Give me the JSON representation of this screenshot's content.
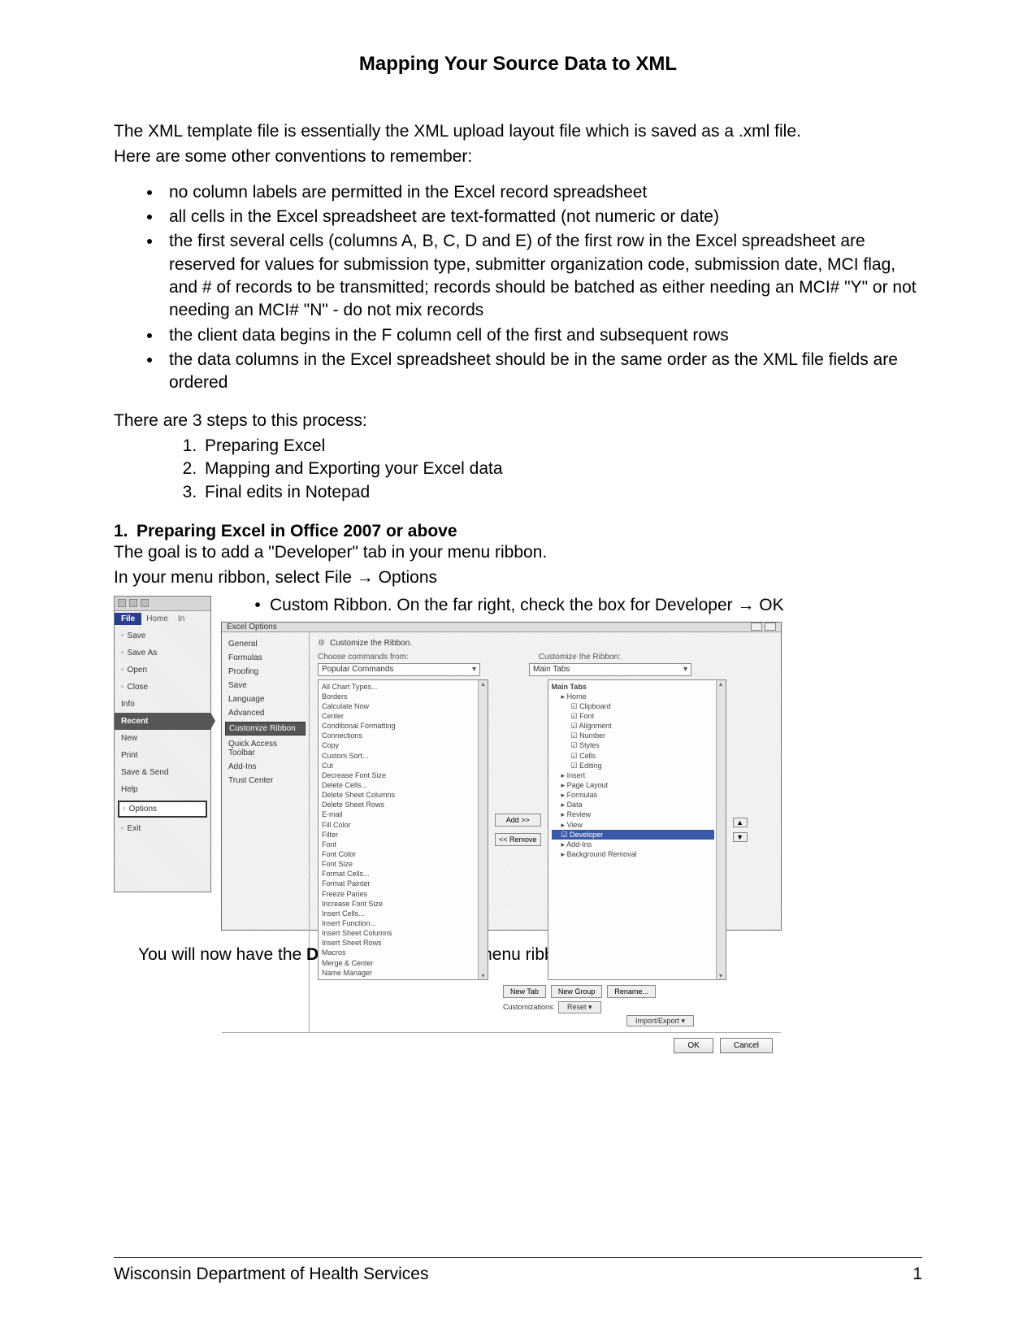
{
  "title": "Mapping Your Source Data to XML",
  "intro1": "The XML template file is essentially the XML upload layout file which is saved as a .xml file.",
  "intro2": "Here are some other conventions to remember:",
  "bullets": [
    "no column labels are permitted in the Excel record spreadsheet",
    "all cells in the Excel spreadsheet are text-formatted (not numeric or date)",
    "the first several cells (columns A, B, C, D and E) of the first row in the Excel spreadsheet are reserved for values for submission type, submitter organization code, submission date, MCI flag, and # of records to be transmitted; records should be batched as either needing an MCI# \"Y\" or not needing an MCI# \"N\" - do not mix records",
    "the client data begins in the F column cell of the first and subsequent rows",
    "the data columns in the Excel spreadsheet should be in the same order as the XML file fields are ordered"
  ],
  "steps_intro": "There are 3 steps to this process:",
  "steps": [
    "Preparing Excel",
    "Mapping and Exporting your Excel data",
    "Final edits in Notepad"
  ],
  "section1": {
    "num": "1.",
    "heading": "Preparing Excel in Office 2007 or above",
    "goal": "The goal is to add a \"Developer\" tab in your menu ribbon.",
    "instr": "In your menu ribbon, select File → Options",
    "custom": "Custom Ribbon. On the far right, check the box for Developer → OK",
    "after": "You will now have the ",
    "after_bold": "Developer",
    "after2": " tab in your menu ribbon:"
  },
  "filemenu": {
    "file_tab": "File",
    "other_tab": "Home",
    "third_tab": "In",
    "items_top": [
      "Save",
      "Save As",
      "Open",
      "Close"
    ],
    "info": "Info",
    "recent": "Recent",
    "items_mid": [
      "New",
      "Print",
      "Save & Send",
      "Help"
    ],
    "options": "Options",
    "exit": "Exit"
  },
  "optdialog": {
    "title": "Excel Options",
    "cats": [
      "General",
      "Formulas",
      "Proofing",
      "Save",
      "Language",
      "Advanced"
    ],
    "cat_sel": "Customize Ribbon",
    "cats2": [
      "Quick Access Toolbar",
      "Add-Ins",
      "Trust Center"
    ],
    "hdr": "Customize the Ribbon.",
    "left_label": "Choose commands from:",
    "left_dd": "Popular Commands",
    "right_label": "Customize the Ribbon:",
    "right_dd": "Main Tabs",
    "left_items": [
      "All Chart Types...",
      "Borders",
      "Calculate Now",
      "Center",
      "Conditional Formatting",
      "Connections",
      "Copy",
      "Custom Sort...",
      "Cut",
      "Decrease Font Size",
      "Delete Cells...",
      "Delete Sheet Columns",
      "Delete Sheet Rows",
      "E-mail",
      "Fill Color",
      "Filter",
      "Font",
      "Font Color",
      "Font Size",
      "Format Cells...",
      "Format Painter",
      "Freeze Panes",
      "Increase Font Size",
      "Insert Cells...",
      "Insert Function...",
      "Insert Sheet Columns",
      "Insert Sheet Rows",
      "Macros",
      "Merge & Center",
      "Name Manager"
    ],
    "right_root": "Main Tabs",
    "right_items": [
      {
        "t": "grp",
        "l": "Home"
      },
      {
        "t": "chk",
        "l": "Clipboard"
      },
      {
        "t": "chk",
        "l": "Font"
      },
      {
        "t": "chk",
        "l": "Alignment"
      },
      {
        "t": "chk",
        "l": "Number"
      },
      {
        "t": "chk",
        "l": "Styles"
      },
      {
        "t": "chk",
        "l": "Cells"
      },
      {
        "t": "chk",
        "l": "Editing"
      },
      {
        "t": "grp",
        "l": "Insert"
      },
      {
        "t": "grp",
        "l": "Page Layout"
      },
      {
        "t": "grp",
        "l": "Formulas"
      },
      {
        "t": "grp",
        "l": "Data"
      },
      {
        "t": "grp",
        "l": "Review"
      },
      {
        "t": "grp",
        "l": "View"
      },
      {
        "t": "dev",
        "l": "☑ Developer"
      },
      {
        "t": "grp",
        "l": "Add-Ins"
      },
      {
        "t": "grp",
        "l": "Background Removal"
      }
    ],
    "add": "Add >>",
    "remove": "<< Remove",
    "newtab": "New Tab",
    "newgroup": "New Group",
    "rename": "Rename...",
    "cust_label": "Customizations:",
    "reset": "Reset ▾",
    "impexp": "Import/Export ▾",
    "ok": "OK",
    "cancel": "Cancel",
    "up": "▲",
    "down": "▼"
  },
  "footer": {
    "org": "Wisconsin Department of Health Services",
    "page": "1"
  }
}
